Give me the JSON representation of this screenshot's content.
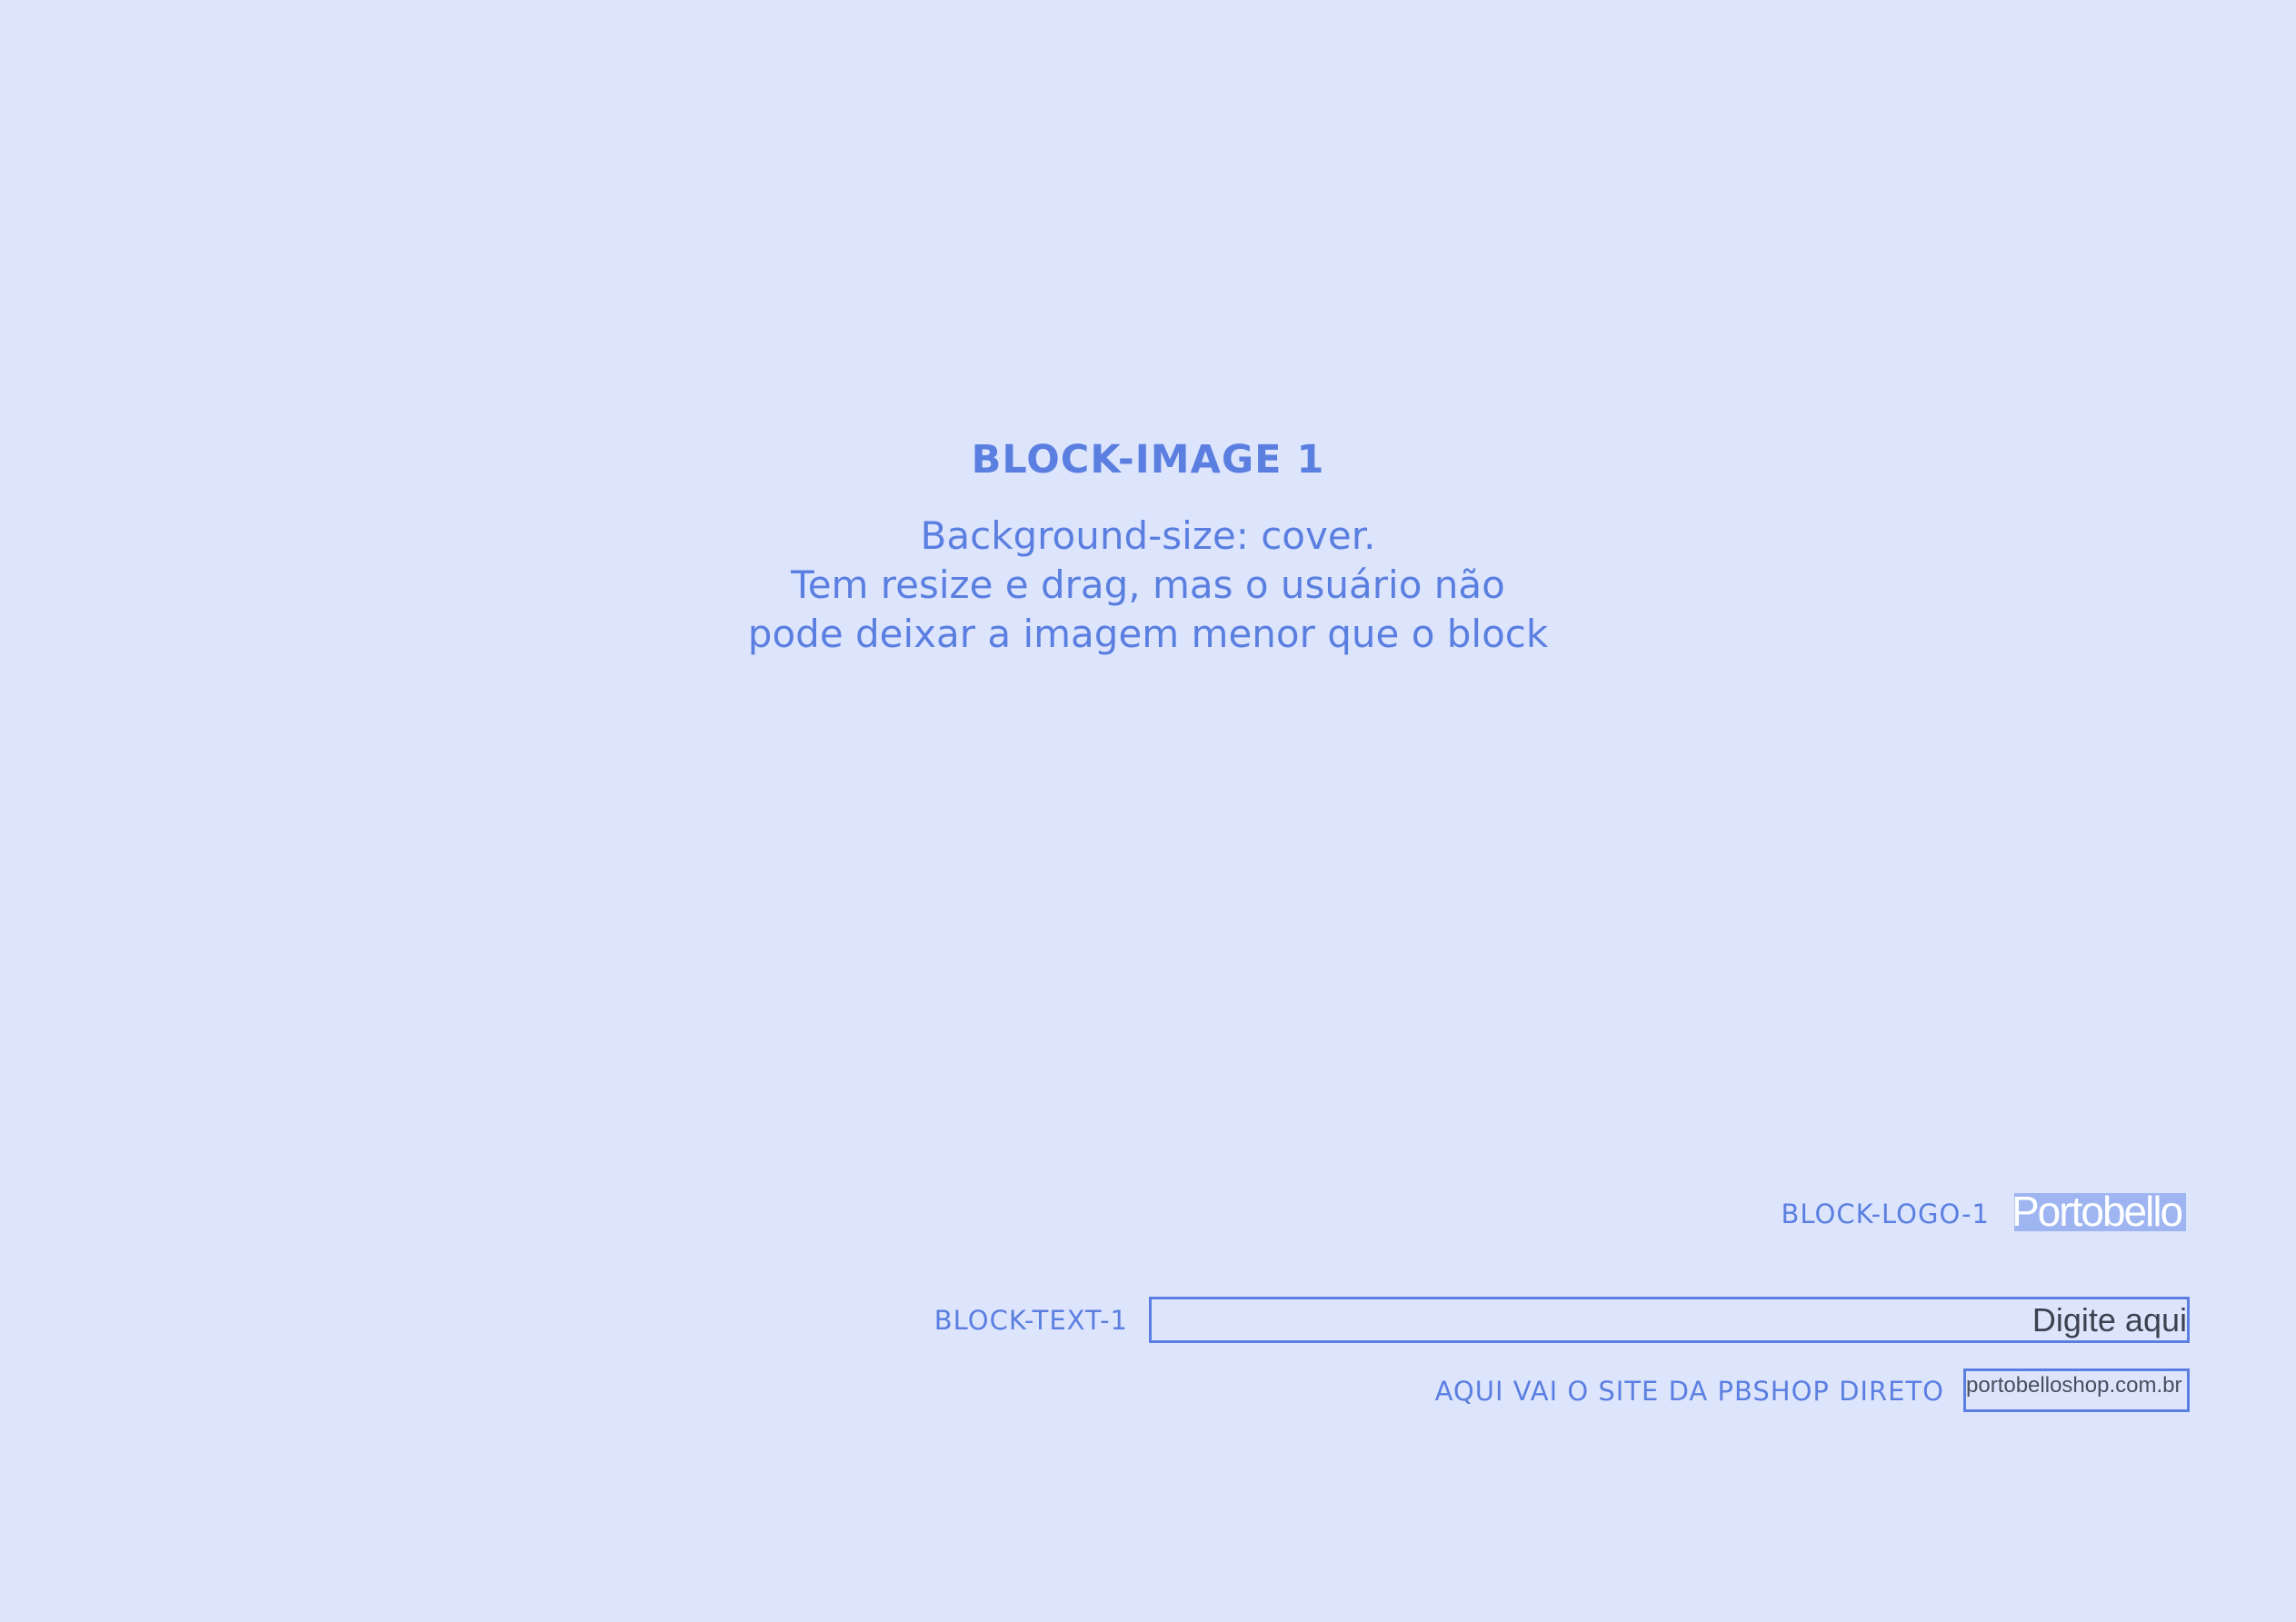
{
  "block_image": {
    "title": "BLOCK-IMAGE 1",
    "description_lines": [
      "Background-size: cover.",
      "Tem resize e drag, mas o usuário não",
      "pode deixar a imagem menor que o block"
    ]
  },
  "block_logo": {
    "label": "BLOCK-LOGO-1",
    "logo_text": "Portobello"
  },
  "block_text": {
    "label": "BLOCK-TEXT-1",
    "placeholder": "Digite aqui"
  },
  "site": {
    "label": "AQUI VAI O SITE DA PBSHOP DIRETO",
    "value": "portobelloshop.com.br"
  },
  "colors": {
    "background": "#dde5fd",
    "accent": "#5b7fe0",
    "logo_highlight": "#9eb5f1",
    "input_text": "#3e4250"
  }
}
